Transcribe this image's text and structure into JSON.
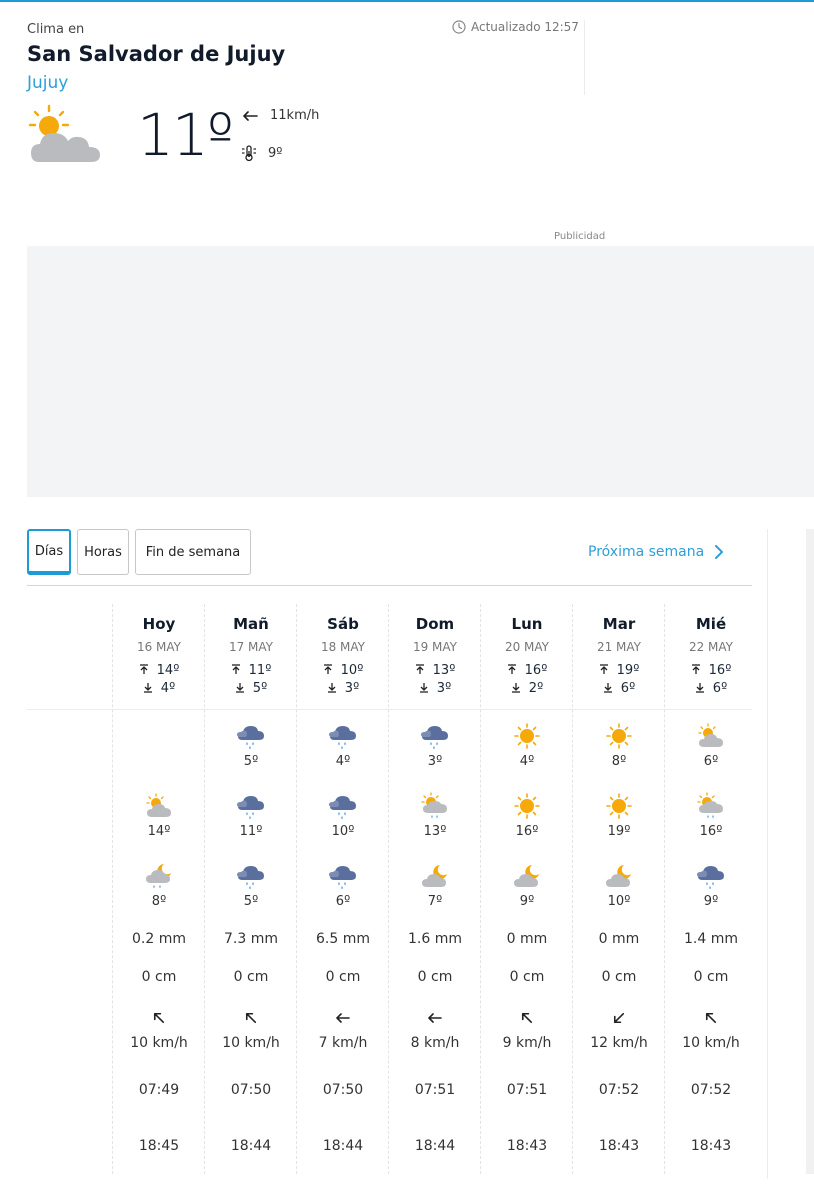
{
  "header": {
    "clima_en": "Clima en",
    "city": "San Salvador de Jujuy",
    "region": "Jujuy",
    "updated": "Actualizado 12:57"
  },
  "current": {
    "icon": "sun-cloud-icon",
    "temp": "11º",
    "wind": "11km/h",
    "wind_direction": "W",
    "feels_like": "9º"
  },
  "ad": {
    "label": "Publicidad"
  },
  "tabs": [
    {
      "label": "Días",
      "active": true
    },
    {
      "label": "Horas",
      "active": false
    },
    {
      "label": "Fin de semana",
      "active": false
    }
  ],
  "next_week": "Próxima semana",
  "colors": {
    "accent": "#1d9bd6",
    "sun": "#f5a90b",
    "cloud": "#b9bbbf",
    "rain_cloud": "#5b6f9e"
  },
  "days": [
    {
      "name": "Hoy",
      "date": "16 MAY",
      "max": "14º",
      "min": "4º",
      "night_icon": null,
      "night_temp": null,
      "day_icon": "sun-cloud-icon",
      "day_temp": "14º",
      "late_icon": "moon-cloud-rain-icon",
      "late_temp": "8º",
      "rain": "0.2 mm",
      "snow": "0 cm",
      "wind_dir": "SW",
      "wind": "10 km/h",
      "sunrise": "07:49",
      "sunset": "18:45"
    },
    {
      "name": "Mañ",
      "date": "17 MAY",
      "max": "11º",
      "min": "5º",
      "night_icon": "rain-cloud-icon",
      "night_temp": "5º",
      "day_icon": "rain-cloud-icon",
      "day_temp": "11º",
      "late_icon": "rain-cloud-icon",
      "late_temp": "5º",
      "rain": "7.3 mm",
      "snow": "0 cm",
      "wind_dir": "SW",
      "wind": "10 km/h",
      "sunrise": "07:50",
      "sunset": "18:44"
    },
    {
      "name": "Sáb",
      "date": "18 MAY",
      "max": "10º",
      "min": "3º",
      "night_icon": "rain-cloud-icon",
      "night_temp": "4º",
      "day_icon": "rain-cloud-icon",
      "day_temp": "10º",
      "late_icon": "rain-cloud-icon",
      "late_temp": "6º",
      "rain": "6.5 mm",
      "snow": "0 cm",
      "wind_dir": "W",
      "wind": "7 km/h",
      "sunrise": "07:50",
      "sunset": "18:44"
    },
    {
      "name": "Dom",
      "date": "19 MAY",
      "max": "13º",
      "min": "3º",
      "night_icon": "rain-cloud-icon",
      "night_temp": "3º",
      "day_icon": "sun-cloud-rain-icon",
      "day_temp": "13º",
      "late_icon": "moon-cloud-icon",
      "late_temp": "7º",
      "rain": "1.6 mm",
      "snow": "0 cm",
      "wind_dir": "W",
      "wind": "8 km/h",
      "sunrise": "07:51",
      "sunset": "18:44"
    },
    {
      "name": "Lun",
      "date": "20 MAY",
      "max": "16º",
      "min": "2º",
      "night_icon": "sun-icon",
      "night_temp": "4º",
      "day_icon": "sun-icon",
      "day_temp": "16º",
      "late_icon": "moon-cloud-icon",
      "late_temp": "9º",
      "rain": "0 mm",
      "snow": "0 cm",
      "wind_dir": "SW",
      "wind": "9 km/h",
      "sunrise": "07:51",
      "sunset": "18:43"
    },
    {
      "name": "Mar",
      "date": "21 MAY",
      "max": "19º",
      "min": "6º",
      "night_icon": "sun-icon",
      "night_temp": "8º",
      "day_icon": "sun-icon",
      "day_temp": "19º",
      "late_icon": "moon-cloud-icon",
      "late_temp": "10º",
      "rain": "0 mm",
      "snow": "0 cm",
      "wind_dir": "SE",
      "wind": "12 km/h",
      "sunrise": "07:52",
      "sunset": "18:43"
    },
    {
      "name": "Mié",
      "date": "22 MAY",
      "max": "16º",
      "min": "6º",
      "night_icon": "sun-cloud-icon",
      "night_temp": "6º",
      "day_icon": "sun-cloud-rain-icon",
      "day_temp": "16º",
      "late_icon": "rain-cloud-icon",
      "late_temp": "9º",
      "rain": "1.4 mm",
      "snow": "0 cm",
      "wind_dir": "SW",
      "wind": "10 km/h",
      "sunrise": "07:52",
      "sunset": "18:43"
    }
  ]
}
